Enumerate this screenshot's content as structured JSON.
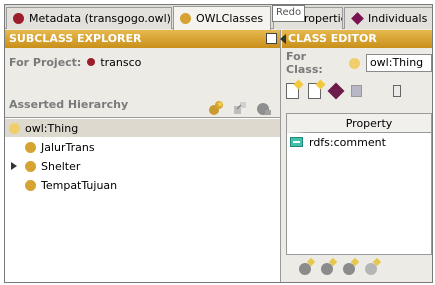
{
  "tabs": [
    {
      "label": "Metadata (transgogo.owl)",
      "icon": "red-circle-icon"
    },
    {
      "label": "OWLClasses",
      "icon": "gold-circle-icon"
    },
    {
      "label": "roperties",
      "icon": ""
    },
    {
      "label": "Individuals",
      "icon": "purple-diamond-icon"
    }
  ],
  "tooltip": "Redo",
  "subclass_explorer": {
    "header": "SUBCLASS EXPLORER",
    "project_label": "For Project:",
    "project_value": "transco",
    "hierarchy_label": "Asserted Hierarchy",
    "tree": [
      {
        "label": "owl:Thing",
        "selected": true,
        "expander": false
      },
      {
        "label": "JalurTrans",
        "selected": false,
        "expander": false
      },
      {
        "label": "Shelter",
        "selected": false,
        "expander": true
      },
      {
        "label": "TempatTujuan",
        "selected": false,
        "expander": false
      }
    ]
  },
  "class_editor": {
    "header": "CLASS EDITOR",
    "class_label": "For Class:",
    "class_value": "owl:Thing",
    "table_header": "Property",
    "properties": [
      {
        "label": "rdfs:comment"
      }
    ]
  },
  "colors": {
    "header_gold": "#d9a52d",
    "class_gold": "#d6a333",
    "project_red": "#9c1d2b",
    "property_teal": "#44c0aa"
  }
}
